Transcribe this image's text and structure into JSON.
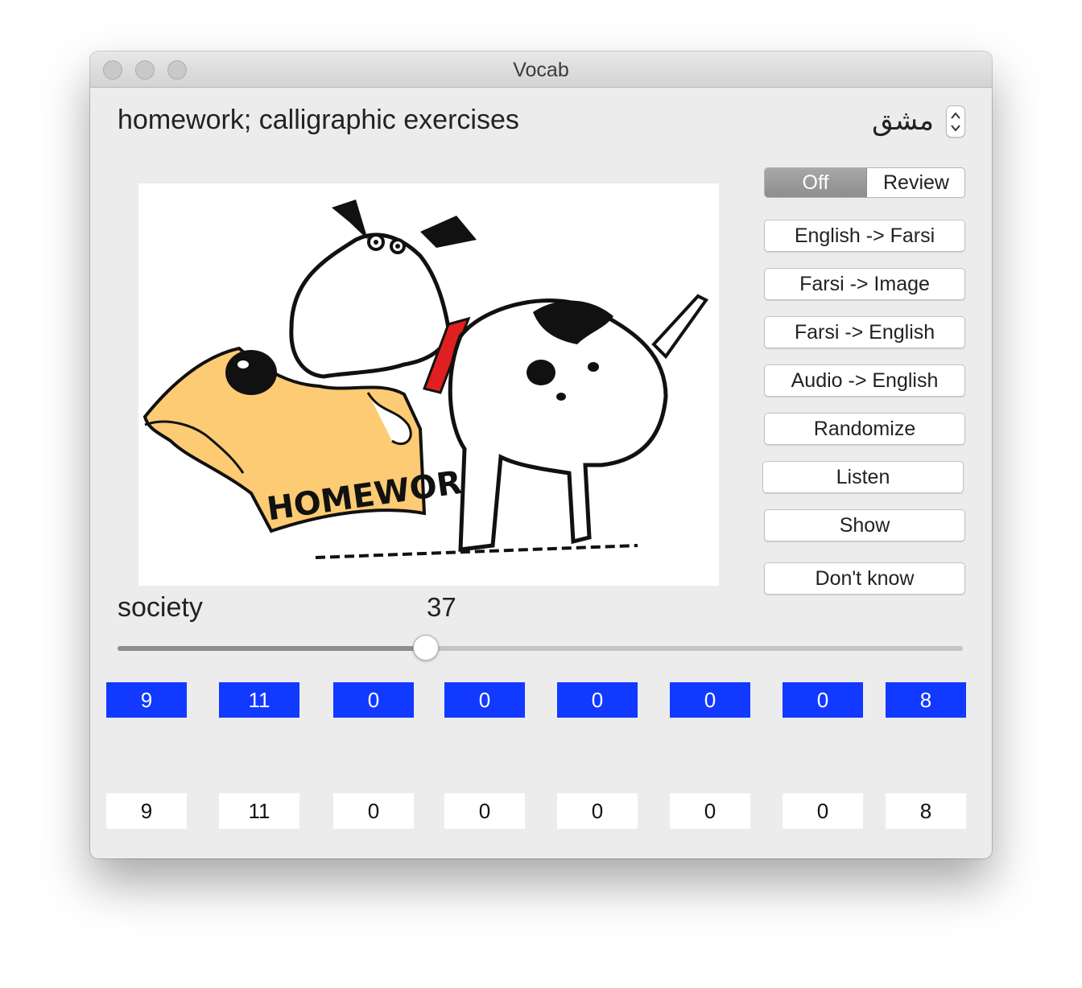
{
  "window": {
    "title": "Vocab"
  },
  "word": {
    "english": "homework; calligraphic exercises",
    "farsi": "مشق"
  },
  "mode": {
    "options": [
      "Off",
      "Review"
    ],
    "selected": "Off"
  },
  "buttons": {
    "english_to_farsi": "English -> Farsi",
    "farsi_to_image": "Farsi -> Image",
    "farsi_to_english": "Farsi -> English",
    "audio_to_english": "Audio -> English",
    "randomize": "Randomize",
    "listen": "Listen",
    "show": "Show",
    "dont_know": "Don't know"
  },
  "image": {
    "caption_text": "HOMEWORK"
  },
  "category": {
    "label": "society",
    "count": "37"
  },
  "slider": {
    "value": 0.365
  },
  "counters": {
    "top": [
      "9",
      "11",
      "0",
      "0",
      "0",
      "0",
      "0",
      "8"
    ],
    "bottom": [
      "9",
      "11",
      "0",
      "0",
      "0",
      "0",
      "0",
      "8"
    ]
  },
  "colors": {
    "counter_top": "#1239ff",
    "counter_bottom": "#ffffff"
  }
}
